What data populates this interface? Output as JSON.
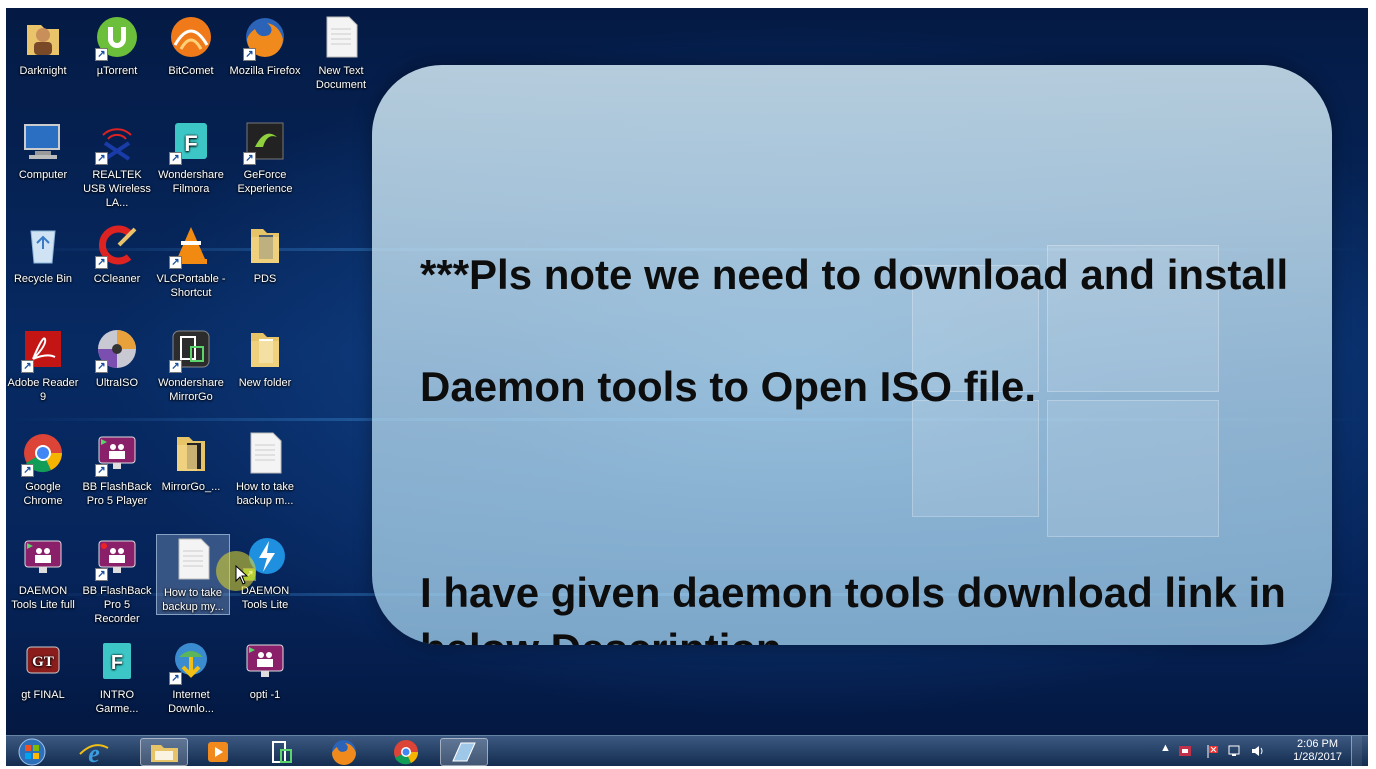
{
  "desktop": {
    "icons": [
      {
        "label": "Darknight",
        "icon": "user-folder-icon"
      },
      {
        "label": "µTorrent",
        "icon": "utorrent-icon"
      },
      {
        "label": "BitComet",
        "icon": "bitcomet-icon"
      },
      {
        "label": "Mozilla Firefox",
        "icon": "firefox-icon"
      },
      {
        "label": "New Text Document",
        "icon": "text-document-icon"
      },
      {
        "label": "Computer",
        "icon": "computer-icon"
      },
      {
        "label": "REALTEK USB Wireless LA...",
        "icon": "realtek-wireless-icon"
      },
      {
        "label": "Wondershare Filmora",
        "icon": "filmora-icon"
      },
      {
        "label": "GeForce Experience",
        "icon": "geforce-icon"
      },
      {
        "label": "Recycle Bin",
        "icon": "recycle-bin-icon"
      },
      {
        "label": "CCleaner",
        "icon": "ccleaner-icon"
      },
      {
        "label": "VLCPortable - Shortcut",
        "icon": "vlc-icon"
      },
      {
        "label": "PDS",
        "icon": "folder-icon"
      },
      {
        "label": "Adobe Reader 9",
        "icon": "adobe-reader-icon"
      },
      {
        "label": "UltraISO",
        "icon": "ultraiso-icon"
      },
      {
        "label": "Wondershare MirrorGo",
        "icon": "mirrorgo-icon"
      },
      {
        "label": "New folder",
        "icon": "folder-icon"
      },
      {
        "label": "Google Chrome",
        "icon": "chrome-icon"
      },
      {
        "label": "BB FlashBack Pro 5 Player",
        "icon": "flashback-player-icon"
      },
      {
        "label": "MirrorGo_...",
        "icon": "folder-icon"
      },
      {
        "label": "How to take backup m...",
        "icon": "text-document-icon"
      },
      {
        "label": "DAEMON Tools Lite full",
        "icon": "daemon-tools-full-icon"
      },
      {
        "label": "BB FlashBack Pro 5 Recorder",
        "icon": "flashback-recorder-icon"
      },
      {
        "label": "How to take backup my...",
        "icon": "text-document-icon"
      },
      {
        "label": "DAEMON Tools Lite",
        "icon": "daemon-tools-lite-icon"
      },
      {
        "label": "gt FINAL",
        "icon": "gt-icon"
      },
      {
        "label": "INTRO Garme...",
        "icon": "filmora-icon"
      },
      {
        "label": "Internet Downlo...",
        "icon": "idm-icon"
      },
      {
        "label": "opti -1",
        "icon": "flashback-player-icon"
      }
    ]
  },
  "note": {
    "line1": "***Pls note we need to download and install",
    "line2": "Daemon tools to Open ISO file.",
    "line3": "I have given daemon tools download link in below Description"
  },
  "taskbar": {
    "items": [
      "start-button-icon",
      "internet-explorer-icon",
      "file-explorer-icon",
      "media-player-icon",
      "mirrorgo-icon",
      "firefox-icon",
      "chrome-icon",
      "recorder-icon"
    ],
    "clock_time": "2:06 PM",
    "clock_date": "1/28/2017"
  },
  "colors": {
    "desktop_bg": "#072a63",
    "note_bg": "#cde4f0",
    "note_text": "#0d0d0d"
  }
}
